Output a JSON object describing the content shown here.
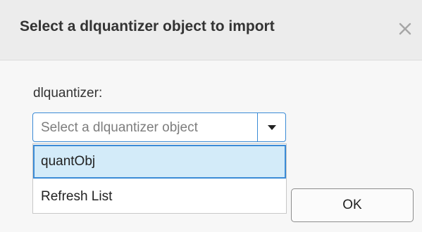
{
  "dialog": {
    "title": "Select a dlquantizer object to import",
    "close_icon": "close-icon"
  },
  "field": {
    "label": "dlquantizer:",
    "placeholder": "Select a dlquantizer object",
    "arrow_icon": "chevron-down-icon"
  },
  "dropdown": {
    "items": [
      {
        "label": "quantObj",
        "selected": true
      },
      {
        "label": "Refresh List",
        "selected": false
      }
    ]
  },
  "buttons": {
    "ok_label": "OK"
  },
  "colors": {
    "accent": "#3b8bd6",
    "selected_bg": "#d3ebf9"
  }
}
